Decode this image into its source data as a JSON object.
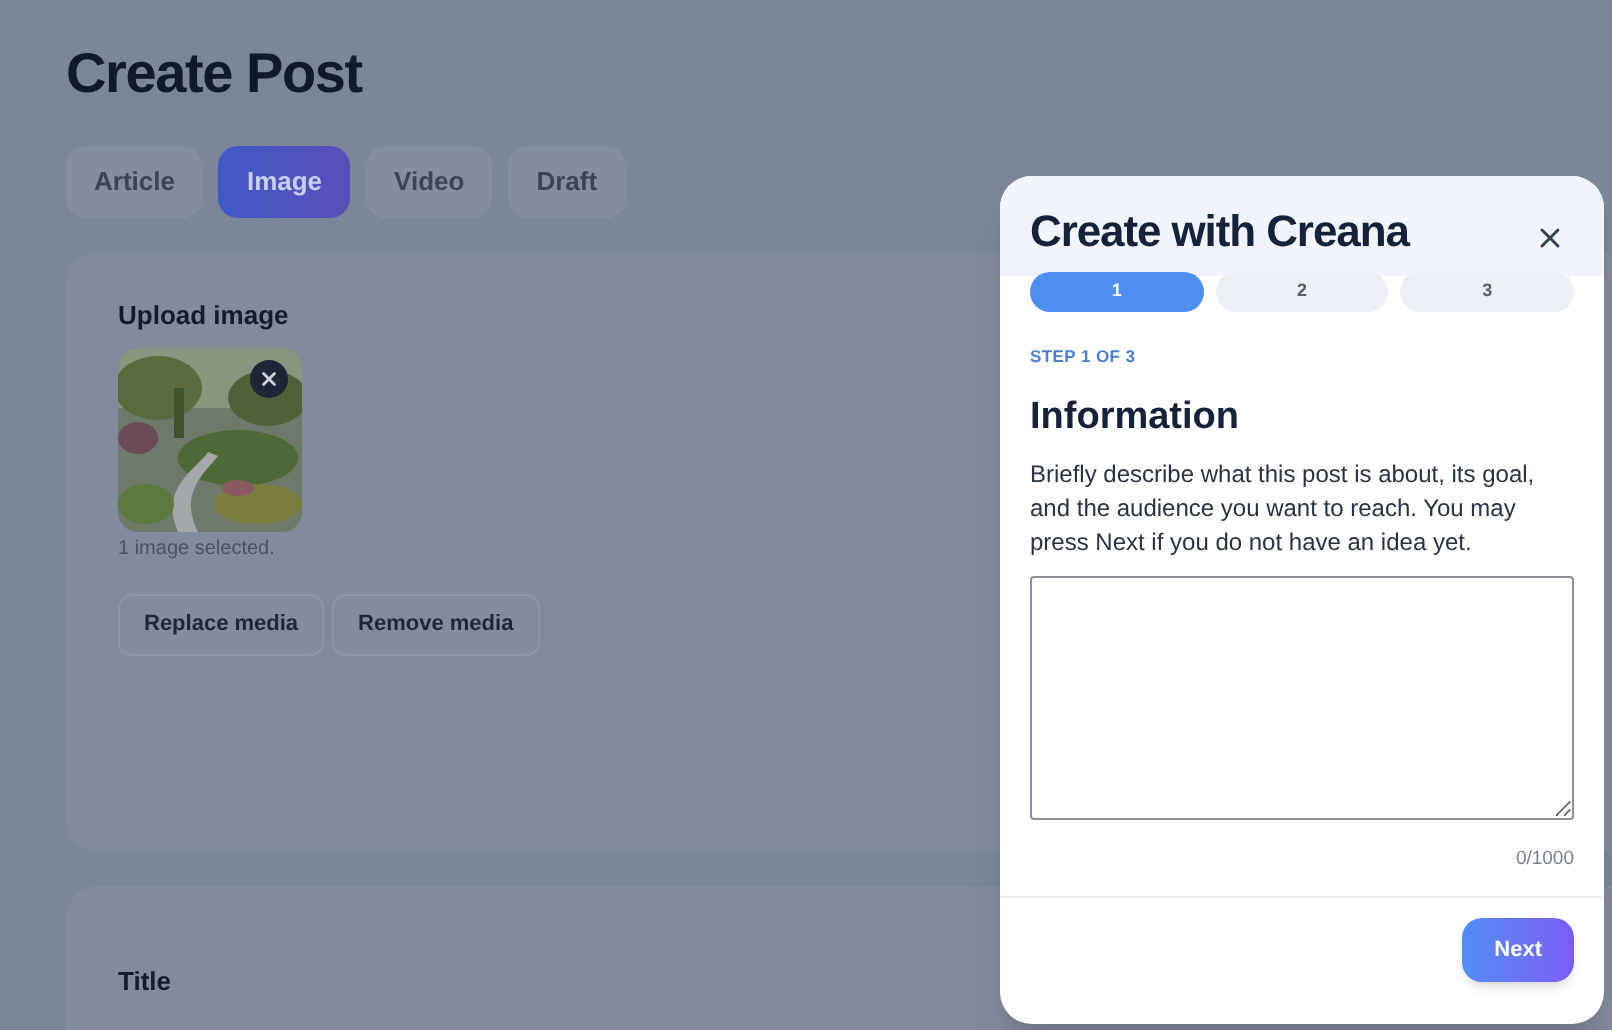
{
  "page": {
    "title": "Create Post"
  },
  "tabs": [
    {
      "label": "Article",
      "selected": false
    },
    {
      "label": "Image",
      "selected": true
    },
    {
      "label": "Video",
      "selected": false
    },
    {
      "label": "Draft",
      "selected": false
    }
  ],
  "upload": {
    "heading": "Upload image",
    "thumbnail": {
      "kind": "picture"
    },
    "status": "1 image selected.",
    "buttons": [
      "Replace media",
      "Remove media"
    ]
  },
  "title_section": {
    "label": "Title"
  },
  "dialog": {
    "title": "Create with Creana",
    "steps": [
      {
        "label": "1",
        "selected": true
      },
      {
        "label": "2",
        "selected": false
      },
      {
        "label": "3",
        "selected": false
      }
    ],
    "step_caption": "STEP 1 OF 3",
    "heading": "Information",
    "description": "Briefly describe what this post is about, its goal, and the audience you want to reach. You may press Next if you do not have an idea yet.",
    "counter": "0/1000",
    "next_button": "Next"
  }
}
